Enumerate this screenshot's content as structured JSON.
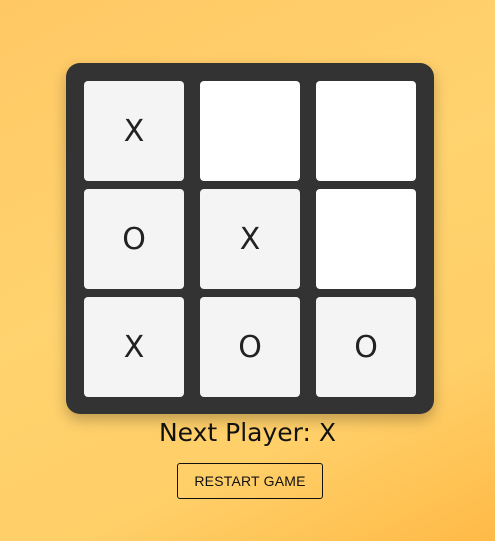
{
  "board": {
    "cells": [
      "X",
      "",
      "",
      "O",
      "X",
      "",
      "X",
      "O",
      "O"
    ]
  },
  "status": {
    "text": "Next Player: X"
  },
  "controls": {
    "restart_label": "RESTART GAME"
  },
  "colors": {
    "background_gradient_start": "#ffc865",
    "background_gradient_end": "#ffba47",
    "board": "#333333",
    "filled_cell": "#f4f4f4",
    "empty_cell": "#ffffff",
    "text": "#222222"
  }
}
